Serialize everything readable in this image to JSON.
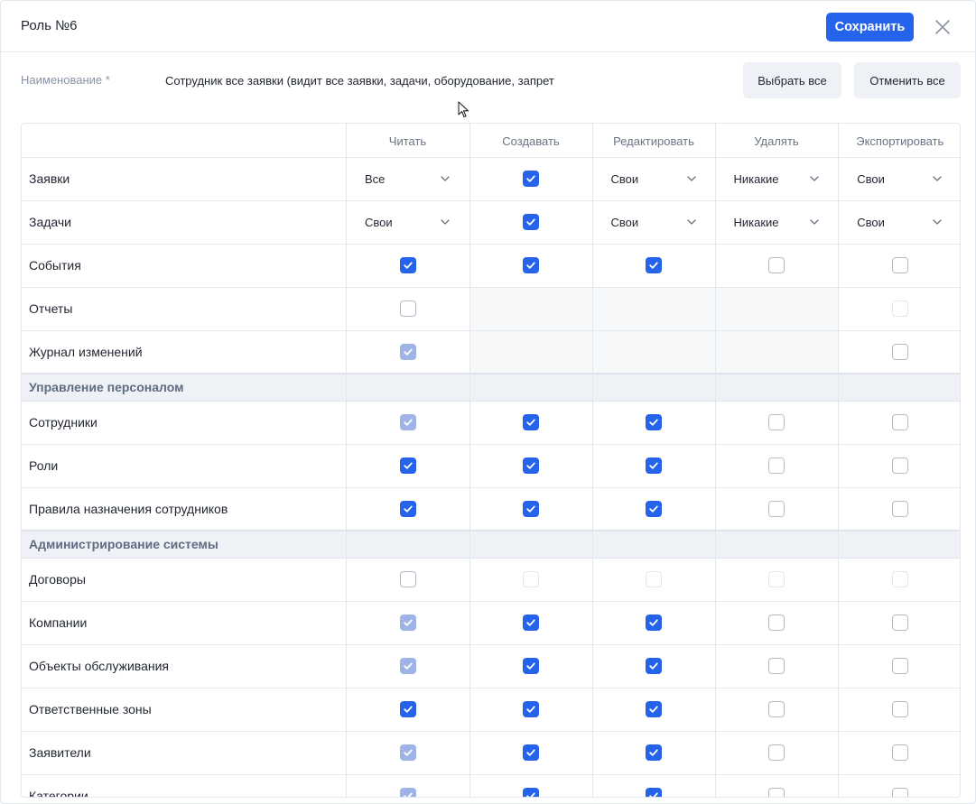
{
  "modal": {
    "title": "Роль №6",
    "save_label": "Сохранить",
    "close_icon": "close-icon"
  },
  "form": {
    "name_label": "Наименование *",
    "name_value": "Сотрудник все заявки (видит все заявки, задачи, оборудование, запрет",
    "select_all_label": "Выбрать все",
    "deselect_all_label": "Отменить все"
  },
  "table": {
    "columns": [
      "",
      "Читать",
      "Создавать",
      "Редактировать",
      "Удалять",
      "Экспортировать"
    ],
    "rows": [
      {
        "type": "data",
        "label": "Заявки",
        "cells": [
          {
            "kind": "select",
            "value": "Все"
          },
          {
            "kind": "checked"
          },
          {
            "kind": "select",
            "value": "Свои"
          },
          {
            "kind": "select",
            "value": "Никакие"
          },
          {
            "kind": "select",
            "value": "Свои"
          }
        ]
      },
      {
        "type": "data",
        "label": "Задачи",
        "cells": [
          {
            "kind": "select",
            "value": "Свои"
          },
          {
            "kind": "checked"
          },
          {
            "kind": "select",
            "value": "Свои"
          },
          {
            "kind": "select",
            "value": "Никакие"
          },
          {
            "kind": "select",
            "value": "Свои"
          }
        ]
      },
      {
        "type": "data",
        "label": "События",
        "cells": [
          {
            "kind": "checked"
          },
          {
            "kind": "checked"
          },
          {
            "kind": "checked"
          },
          {
            "kind": "empty"
          },
          {
            "kind": "empty"
          }
        ]
      },
      {
        "type": "data",
        "label": "Отчеты",
        "cells": [
          {
            "kind": "empty"
          },
          {
            "kind": "none"
          },
          {
            "kind": "none"
          },
          {
            "kind": "none"
          },
          {
            "kind": "empty-disabled"
          }
        ]
      },
      {
        "type": "data",
        "label": "Журнал изменений",
        "cells": [
          {
            "kind": "checked-disabled"
          },
          {
            "kind": "none"
          },
          {
            "kind": "none"
          },
          {
            "kind": "none"
          },
          {
            "kind": "empty"
          }
        ]
      },
      {
        "type": "section",
        "label": "Управление персоналом"
      },
      {
        "type": "data",
        "label": "Сотрудники",
        "cells": [
          {
            "kind": "checked-disabled"
          },
          {
            "kind": "checked"
          },
          {
            "kind": "checked"
          },
          {
            "kind": "empty"
          },
          {
            "kind": "empty"
          }
        ]
      },
      {
        "type": "data",
        "label": "Роли",
        "cells": [
          {
            "kind": "checked"
          },
          {
            "kind": "checked"
          },
          {
            "kind": "checked"
          },
          {
            "kind": "empty"
          },
          {
            "kind": "empty"
          }
        ]
      },
      {
        "type": "data",
        "label": "Правила назначения сотрудников",
        "cells": [
          {
            "kind": "checked"
          },
          {
            "kind": "checked"
          },
          {
            "kind": "checked"
          },
          {
            "kind": "empty"
          },
          {
            "kind": "empty"
          }
        ]
      },
      {
        "type": "section",
        "label": "Администрирование системы"
      },
      {
        "type": "data",
        "label": "Договоры",
        "cells": [
          {
            "kind": "empty"
          },
          {
            "kind": "empty-disabled"
          },
          {
            "kind": "empty-disabled"
          },
          {
            "kind": "empty-disabled"
          },
          {
            "kind": "empty-disabled"
          }
        ]
      },
      {
        "type": "data",
        "label": "Компании",
        "cells": [
          {
            "kind": "checked-disabled"
          },
          {
            "kind": "checked"
          },
          {
            "kind": "checked"
          },
          {
            "kind": "empty"
          },
          {
            "kind": "empty"
          }
        ]
      },
      {
        "type": "data",
        "label": "Объекты обслуживания",
        "cells": [
          {
            "kind": "checked-disabled"
          },
          {
            "kind": "checked"
          },
          {
            "kind": "checked"
          },
          {
            "kind": "empty"
          },
          {
            "kind": "empty"
          }
        ]
      },
      {
        "type": "data",
        "label": "Ответственные зоны",
        "cells": [
          {
            "kind": "checked"
          },
          {
            "kind": "checked"
          },
          {
            "kind": "checked"
          },
          {
            "kind": "empty"
          },
          {
            "kind": "empty"
          }
        ]
      },
      {
        "type": "data",
        "label": "Заявители",
        "cells": [
          {
            "kind": "checked-disabled"
          },
          {
            "kind": "checked"
          },
          {
            "kind": "checked"
          },
          {
            "kind": "empty"
          },
          {
            "kind": "empty"
          }
        ]
      },
      {
        "type": "data",
        "label": "Категории",
        "cells": [
          {
            "kind": "checked-disabled"
          },
          {
            "kind": "checked"
          },
          {
            "kind": "checked"
          },
          {
            "kind": "empty"
          },
          {
            "kind": "empty"
          }
        ]
      }
    ]
  },
  "colors": {
    "accent": "#2563eb",
    "checked_disabled": "#9fb3e6",
    "section_bg": "#eef2f7"
  }
}
